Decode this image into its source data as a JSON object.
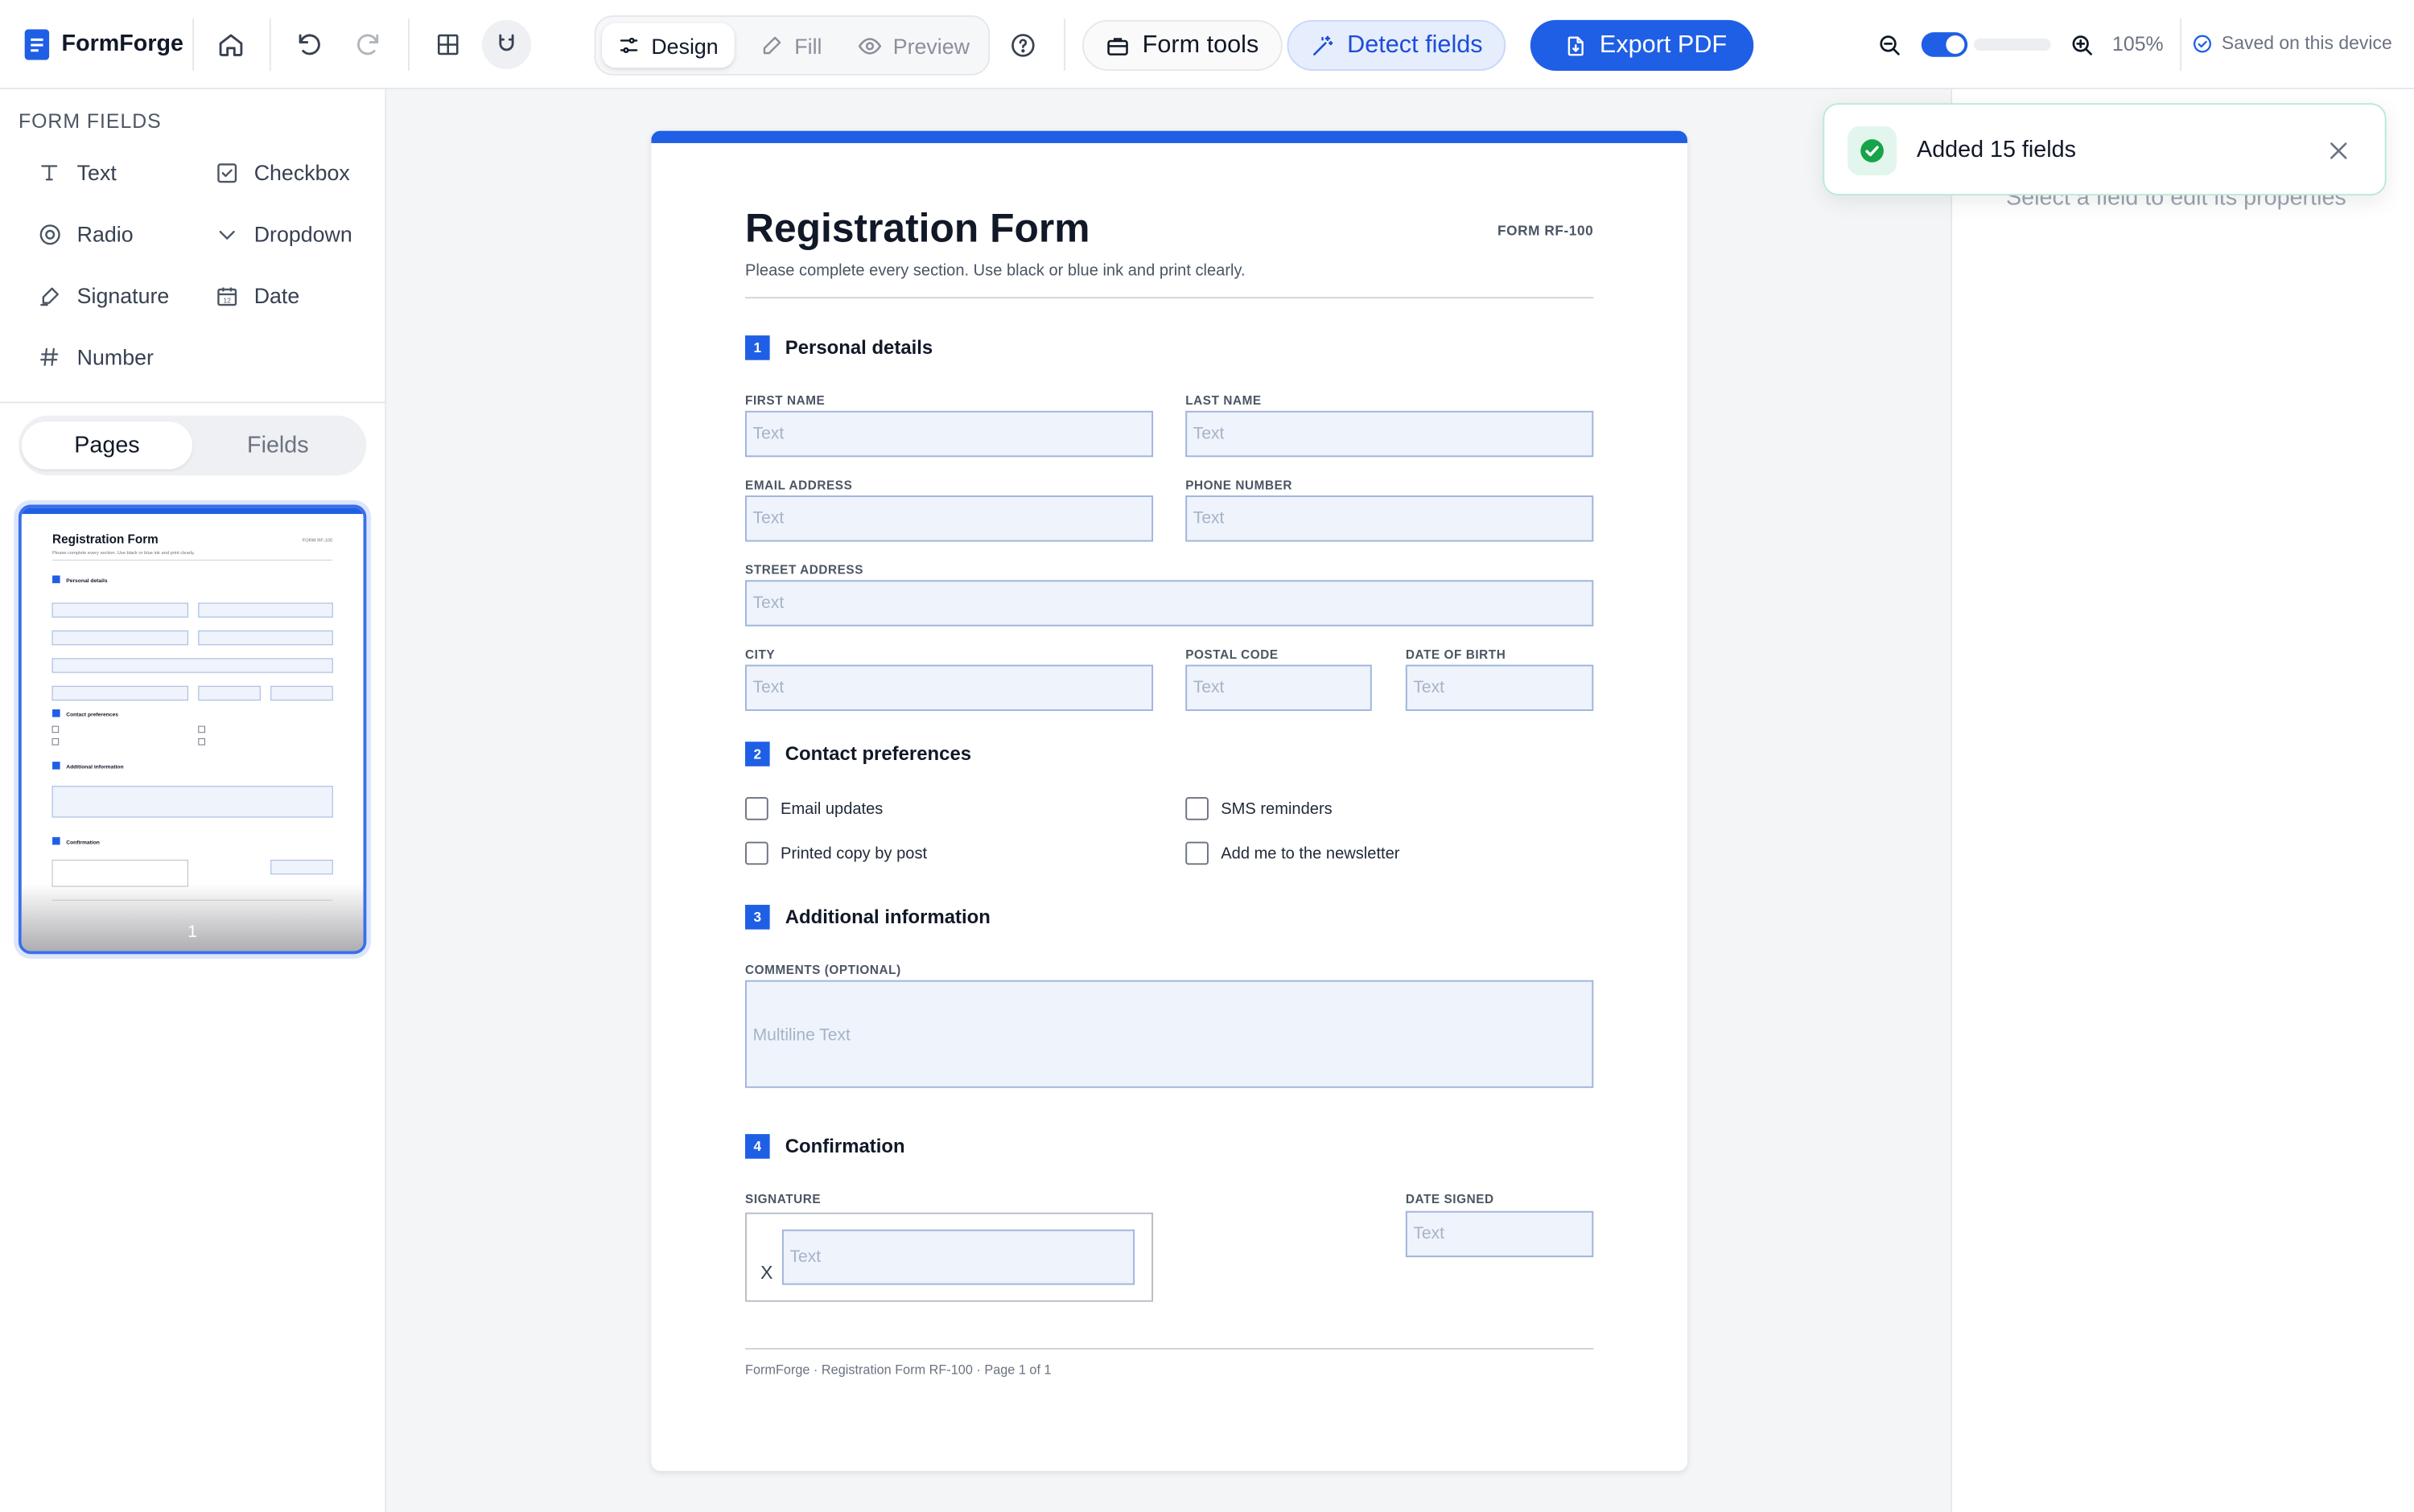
{
  "app": {
    "name": "FormForge",
    "zoom": "105%",
    "save_status": "Saved on this device"
  },
  "toolbar": {
    "modes": [
      {
        "label": "Design",
        "icon": "sliders-icon",
        "active": true
      },
      {
        "label": "Fill",
        "icon": "pen-icon",
        "active": false
      },
      {
        "label": "Preview",
        "icon": "eye-icon",
        "active": false
      }
    ],
    "form_tools_label": "Form tools",
    "detect_fields_label": "Detect fields",
    "export_pdf_label": "Export PDF",
    "snap_enabled": true,
    "accent_color": "#1f5fe5"
  },
  "sidebar": {
    "heading": "FORM FIELDS",
    "field_types": [
      {
        "label": "Text",
        "icon": "text-icon"
      },
      {
        "label": "Checkbox",
        "icon": "checkbox-icon"
      },
      {
        "label": "Radio",
        "icon": "radio-icon"
      },
      {
        "label": "Dropdown",
        "icon": "chevron-down-icon"
      },
      {
        "label": "Signature",
        "icon": "signature-icon"
      },
      {
        "label": "Date",
        "icon": "calendar-icon"
      },
      {
        "label": "Number",
        "icon": "hash-icon"
      }
    ],
    "tabs": [
      {
        "label": "Pages",
        "active": true
      },
      {
        "label": "Fields",
        "active": false
      }
    ],
    "page_thumb_number": "1"
  },
  "form": {
    "title": "Registration Form",
    "code": "FORM RF-100",
    "subtitle": "Please complete every section. Use black or blue ink and print clearly.",
    "sections": [
      {
        "num": "1",
        "title": "Personal details"
      },
      {
        "num": "2",
        "title": "Contact preferences"
      },
      {
        "num": "3",
        "title": "Additional information"
      },
      {
        "num": "4",
        "title": "Confirmation"
      }
    ],
    "fields": {
      "first_name": {
        "label": "FIRST NAME",
        "placeholder": "Text"
      },
      "last_name": {
        "label": "LAST NAME",
        "placeholder": "Text"
      },
      "email": {
        "label": "EMAIL ADDRESS",
        "placeholder": "Text"
      },
      "phone": {
        "label": "PHONE NUMBER",
        "placeholder": "Text"
      },
      "street": {
        "label": "STREET ADDRESS",
        "placeholder": "Text"
      },
      "city": {
        "label": "CITY",
        "placeholder": "Text"
      },
      "postal": {
        "label": "POSTAL CODE",
        "placeholder": "Text"
      },
      "dob": {
        "label": "DATE OF BIRTH",
        "placeholder": "Text"
      },
      "comments": {
        "label": "COMMENTS (OPTIONAL)",
        "placeholder": "Multiline Text"
      },
      "signature": {
        "label": "SIGNATURE",
        "placeholder": "Text",
        "mark": "X"
      },
      "date_signed": {
        "label": "DATE SIGNED",
        "placeholder": "Text"
      }
    },
    "checkboxes": [
      {
        "label": "Email updates",
        "checked": false
      },
      {
        "label": "SMS reminders",
        "checked": false
      },
      {
        "label": "Printed copy by post",
        "checked": false
      },
      {
        "label": "Add me to the newsletter",
        "checked": false
      }
    ],
    "footer": "FormForge · Registration Form RF-100 · Page 1 of 1"
  },
  "right_panel": {
    "hint": "Select a field to edit its properties"
  },
  "toast": {
    "message": "Added 15 fields",
    "status_color": "#16a34a"
  }
}
